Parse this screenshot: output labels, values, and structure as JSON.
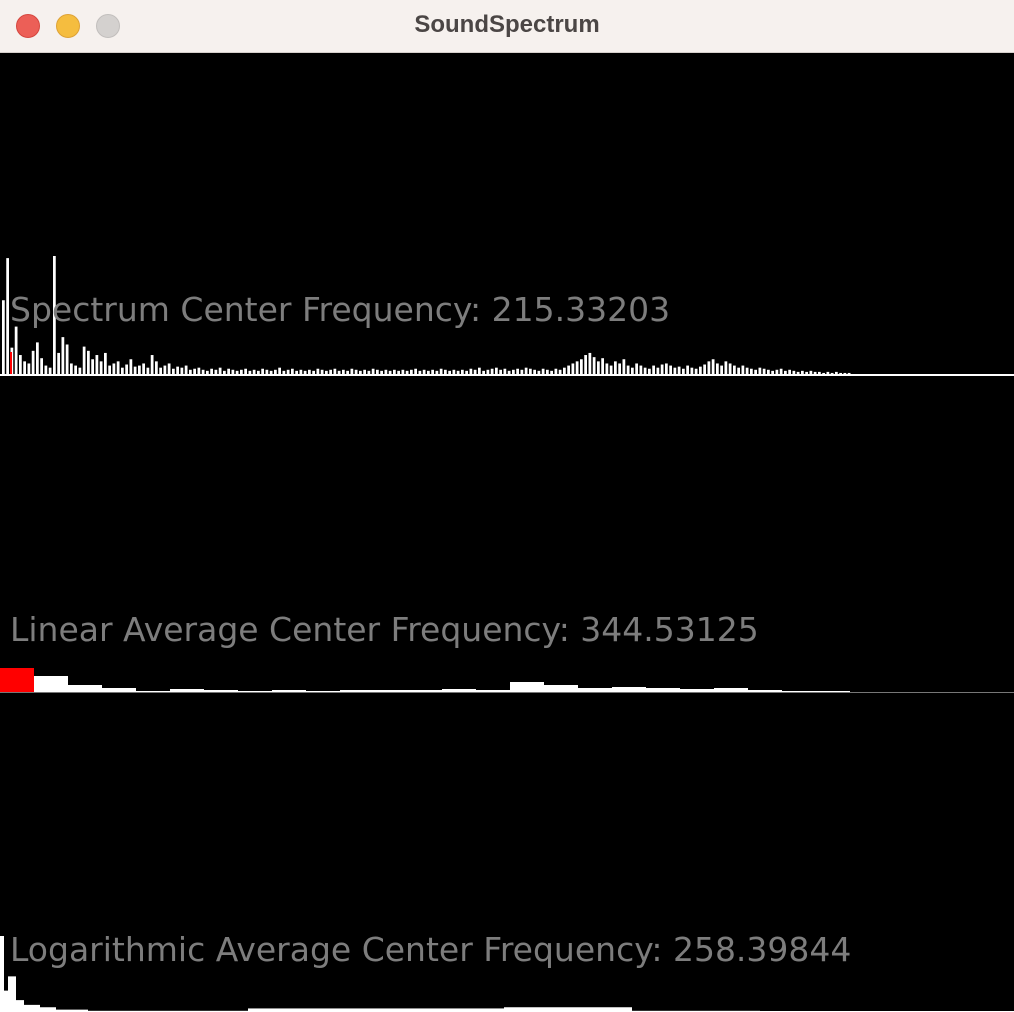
{
  "window": {
    "title": "SoundSpectrum",
    "controls": [
      "close",
      "minimize",
      "zoom"
    ]
  },
  "colors": {
    "background": "#000000",
    "bar": "#ffffff",
    "center_marker": "#ff0000",
    "label": "#7d7d7d",
    "baseline": "#ffffff"
  },
  "panels": {
    "spectrum": {
      "label": "Spectrum Center Frequency: 215.33203",
      "center_frequency": 215.33203
    },
    "linear": {
      "label": "Linear Average Center Frequency: 344.53125",
      "center_frequency": 344.53125
    },
    "logarithmic": {
      "label": "Logarithmic Average Center Frequency: 258.39844",
      "center_frequency": 258.39844
    }
  },
  "chart_data": [
    {
      "type": "bar",
      "name": "spectrum",
      "title": "Spectrum Center Frequency: 215.33203",
      "highlight_index": 4,
      "values": [
        70,
        110,
        25,
        45,
        18,
        12,
        10,
        22,
        30,
        15,
        8,
        6,
        112,
        20,
        35,
        28,
        10,
        8,
        6,
        26,
        22,
        14,
        18,
        12,
        20,
        8,
        10,
        12,
        6,
        9,
        14,
        7,
        8,
        10,
        6,
        18,
        12,
        6,
        8,
        10,
        5,
        7,
        6,
        8,
        4,
        5,
        6,
        4,
        3,
        5,
        4,
        6,
        3,
        5,
        4,
        3,
        4,
        5,
        3,
        4,
        3,
        5,
        4,
        3,
        4,
        6,
        3,
        4,
        5,
        3,
        4,
        3,
        4,
        3,
        5,
        4,
        3,
        4,
        5,
        3,
        4,
        3,
        5,
        4,
        3,
        4,
        3,
        5,
        4,
        3,
        4,
        3,
        4,
        3,
        4,
        3,
        4,
        5,
        3,
        4,
        3,
        4,
        3,
        5,
        4,
        3,
        4,
        3,
        4,
        3,
        5,
        4,
        6,
        3,
        4,
        5,
        6,
        4,
        5,
        3,
        4,
        5,
        4,
        6,
        5,
        4,
        3,
        5,
        4,
        3,
        5,
        4,
        6,
        8,
        10,
        12,
        14,
        18,
        20,
        16,
        12,
        15,
        10,
        8,
        12,
        10,
        14,
        8,
        6,
        10,
        8,
        6,
        5,
        8,
        6,
        9,
        10,
        8,
        6,
        7,
        5,
        8,
        6,
        5,
        7,
        9,
        12,
        14,
        10,
        8,
        12,
        10,
        8,
        6,
        8,
        6,
        5,
        4,
        6,
        5,
        4,
        3,
        4,
        5,
        3,
        4,
        3,
        2,
        3,
        2,
        3,
        2,
        2,
        1,
        2,
        1,
        2,
        1,
        1,
        1
      ]
    },
    {
      "type": "bar",
      "name": "linear",
      "title": "Linear Average Center Frequency: 344.53125",
      "highlight_index": 0,
      "values": [
        24,
        16,
        7,
        4,
        1,
        3,
        2,
        1,
        2,
        1,
        2,
        2,
        2,
        3,
        2,
        10,
        7,
        4,
        5,
        4,
        3,
        4,
        2,
        1,
        1
      ]
    },
    {
      "type": "bar",
      "name": "logarithmic",
      "title": "Logarithmic Average Center Frequency: 258.39844",
      "highlight_index": 0,
      "values": [
        64,
        18,
        30,
        10,
        6,
        4,
        2,
        1,
        1,
        1,
        3,
        3,
        4,
        1,
        0,
        0
      ]
    }
  ]
}
